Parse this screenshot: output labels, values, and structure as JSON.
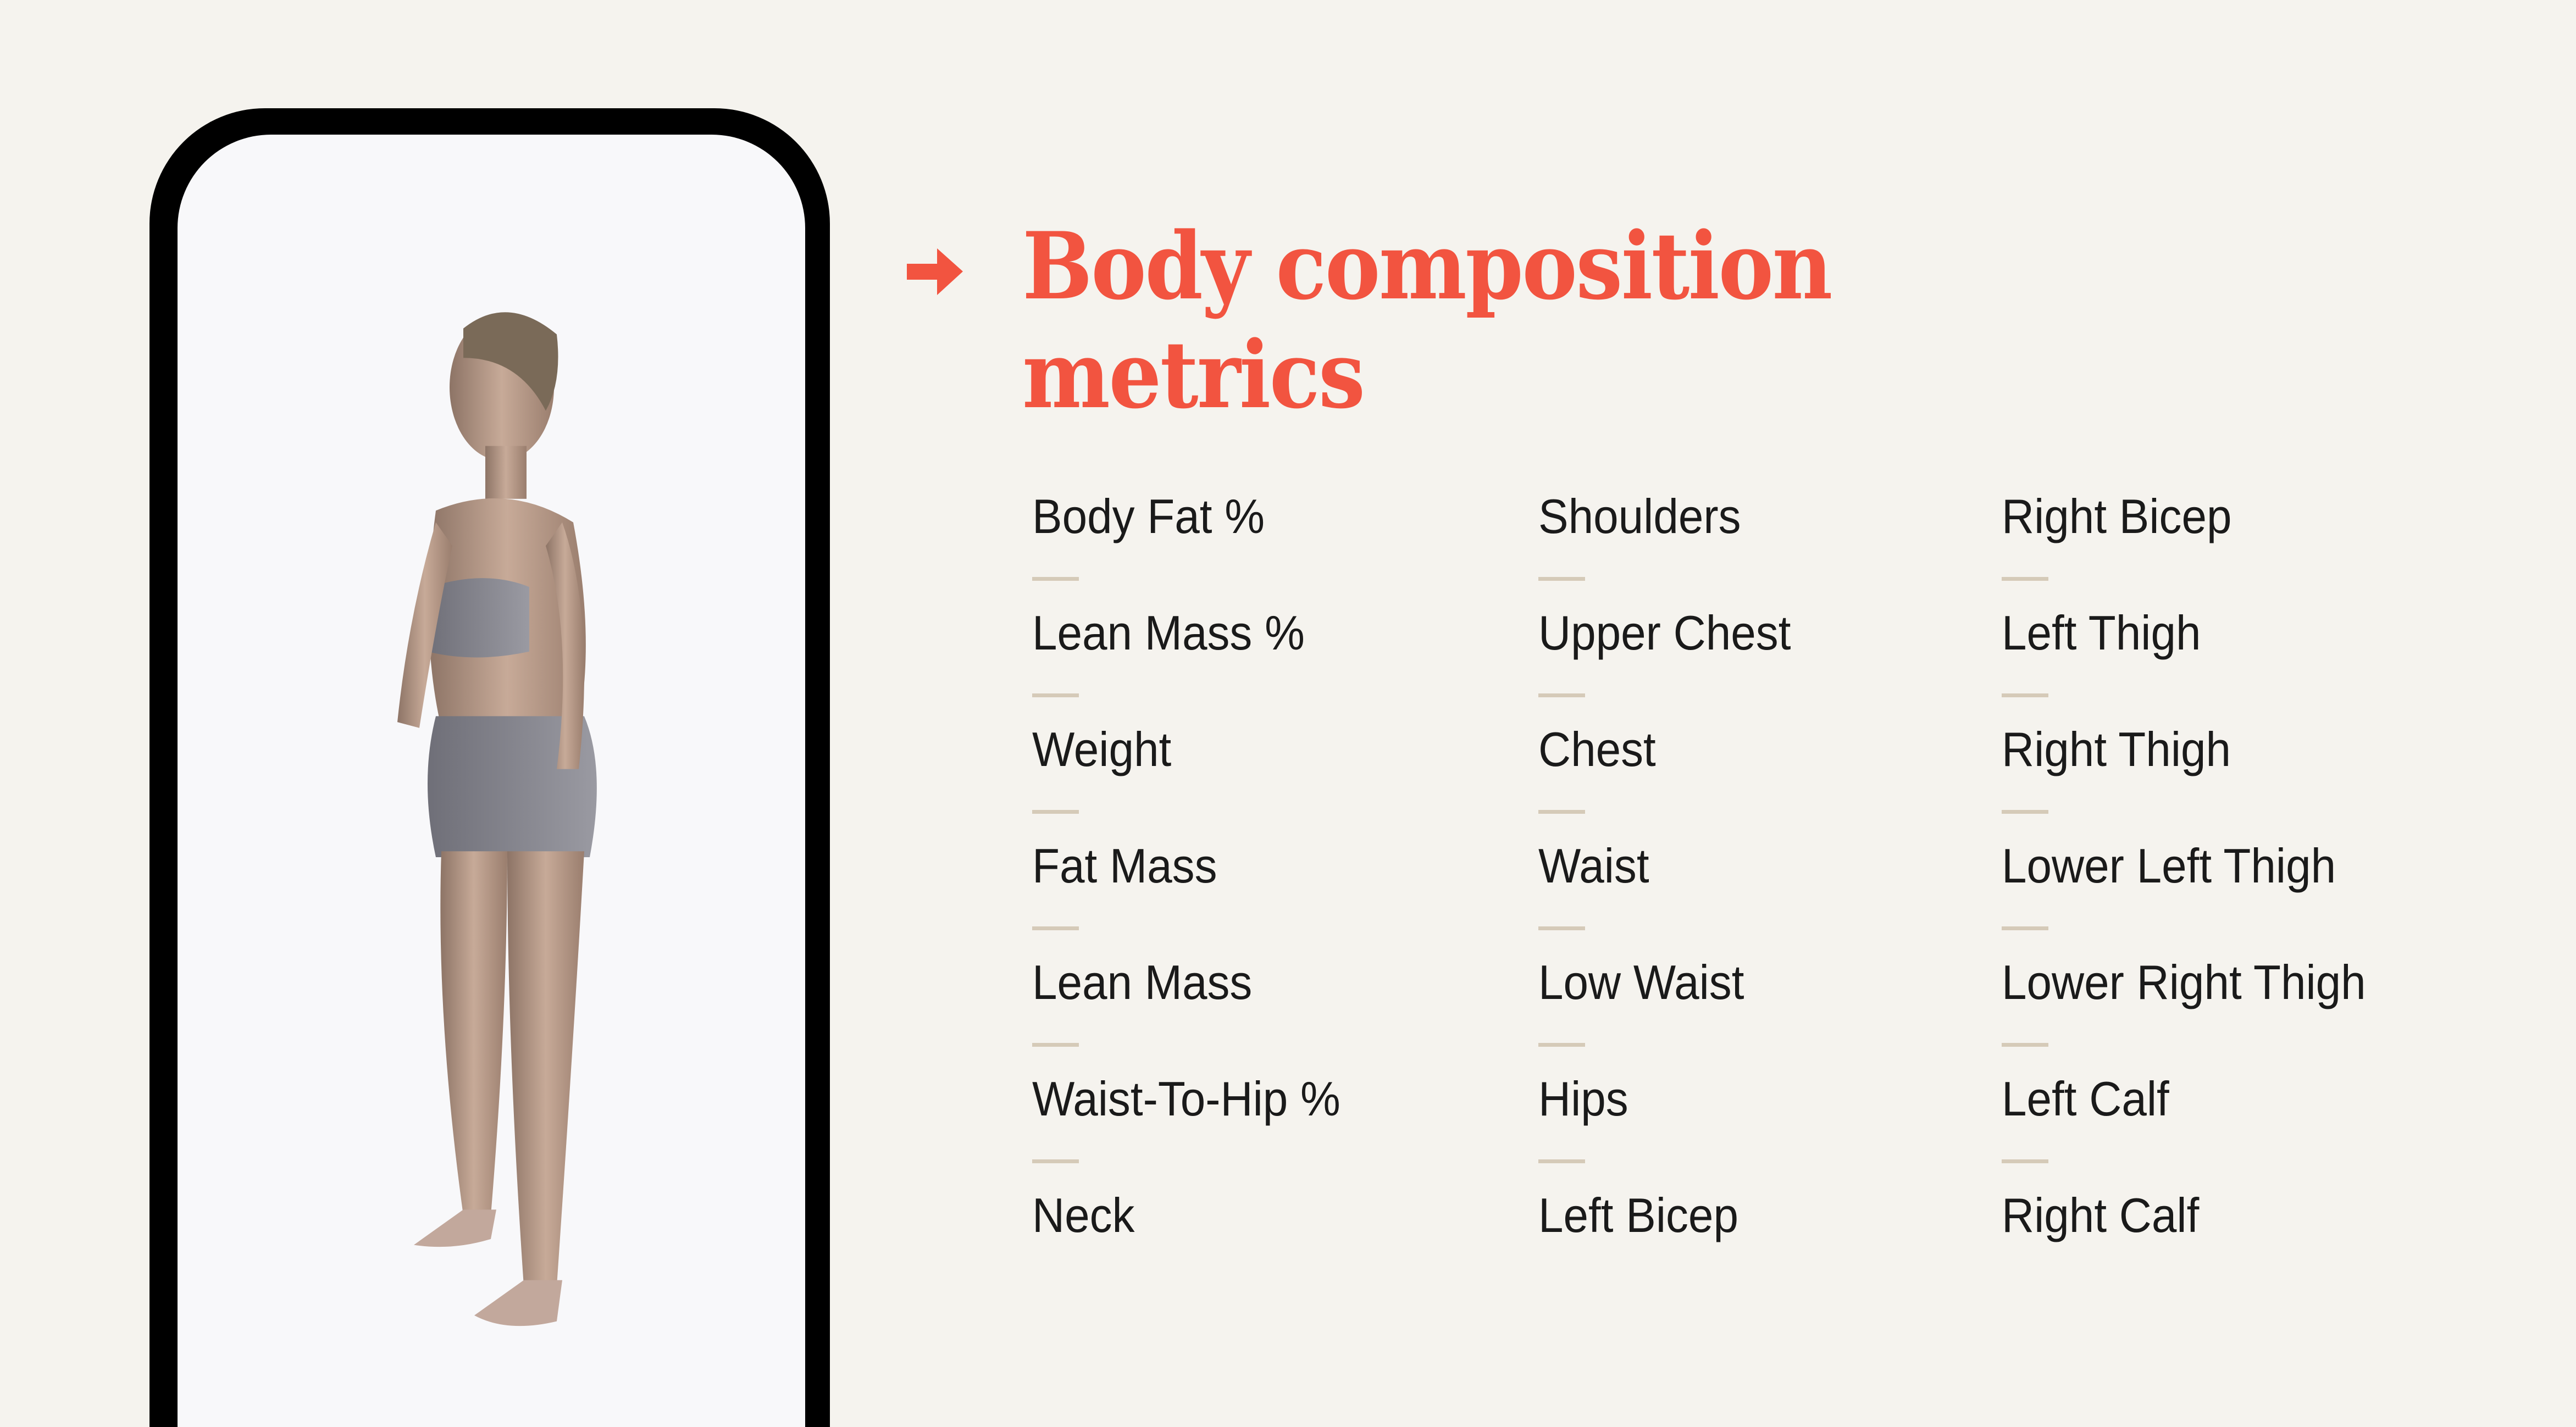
{
  "heading": {
    "icon": "arrow-right-icon",
    "line1": "Body composition",
    "line2": "metrics"
  },
  "colors": {
    "accent": "#f25440",
    "background": "#f5f3ee",
    "divider": "#d5cab8",
    "text": "#1a1a1a",
    "phone_frame": "#000000",
    "screen": "#f8f8fa"
  },
  "phone": {
    "content": "3D body scan avatar of a woman standing, side view"
  },
  "metrics": {
    "column1": [
      "Body Fat %",
      "Lean Mass %",
      "Weight",
      "Fat Mass",
      "Lean Mass",
      "Waist-To-Hip %",
      "Neck"
    ],
    "column2": [
      "Shoulders",
      "Upper Chest",
      "Chest",
      "Waist",
      "Low Waist",
      "Hips",
      "Left Bicep"
    ],
    "column3": [
      "Right Bicep",
      "Left Thigh",
      "Right Thigh",
      "Lower Left Thigh",
      "Lower Right Thigh",
      "Left Calf",
      "Right Calf"
    ]
  }
}
